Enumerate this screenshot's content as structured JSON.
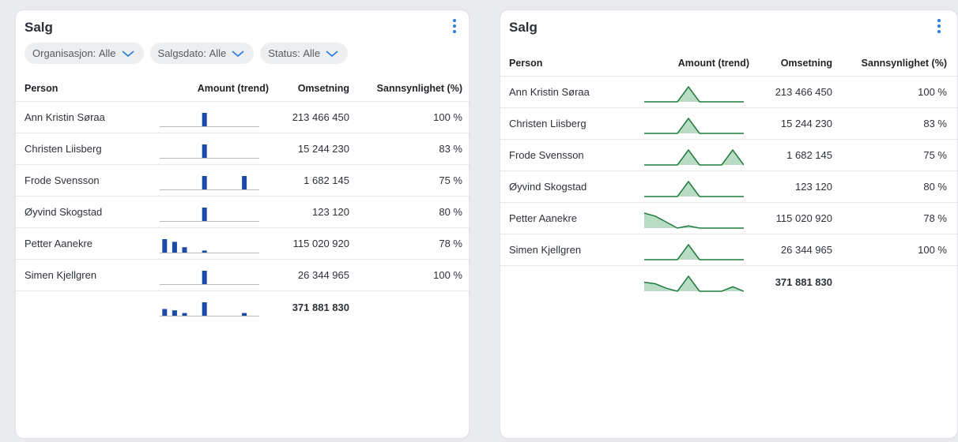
{
  "colors": {
    "bar": "#1b4aa8",
    "line": "#1e7a3c",
    "area": "#b8dcc4",
    "accent": "#2a7de1"
  },
  "left": {
    "title": "Salg",
    "filters": [
      {
        "label": "Organisasjon:",
        "value": "Alle"
      },
      {
        "label": "Salgsdato:",
        "value": "Alle"
      },
      {
        "label": "Status:",
        "value": "Alle"
      }
    ],
    "columns": {
      "person": "Person",
      "trend": "Amount (trend)",
      "omsetning": "Omsetning",
      "sannsynlighet": "Sannsynlighet (%)"
    },
    "rows": [
      {
        "person": "Ann Kristin Søraa",
        "omsetning": "213 466 450",
        "sannsynlighet": "100 %",
        "trend": [
          0,
          0,
          0,
          0,
          1,
          0,
          0,
          0,
          0,
          0
        ]
      },
      {
        "person": "Christen Liisberg",
        "omsetning": "15 244 230",
        "sannsynlighet": "83 %",
        "trend": [
          0,
          0,
          0,
          0,
          1,
          0,
          0,
          0,
          0,
          0
        ]
      },
      {
        "person": "Frode Svensson",
        "omsetning": "1 682 145",
        "sannsynlighet": "75 %",
        "trend": [
          0,
          0,
          0,
          0,
          1,
          0,
          0,
          0,
          1,
          0
        ]
      },
      {
        "person": "Øyvind Skogstad",
        "omsetning": "123 120",
        "sannsynlighet": "80 %",
        "trend": [
          0,
          0,
          0,
          0,
          1,
          0,
          0,
          0,
          0,
          0
        ]
      },
      {
        "person": "Petter Aanekre",
        "omsetning": "115 020 920",
        "sannsynlighet": "78 %",
        "trend": [
          1,
          0.8,
          0.4,
          0,
          0.15,
          0,
          0,
          0,
          0,
          0
        ]
      },
      {
        "person": "Simen Kjellgren",
        "omsetning": "26 344 965",
        "sannsynlighet": "100 %",
        "trend": [
          0,
          0,
          0,
          0,
          1,
          0,
          0,
          0,
          0,
          0
        ]
      }
    ],
    "total": {
      "omsetning": "371 881 830",
      "trend": [
        0.5,
        0.4,
        0.2,
        0,
        1,
        0,
        0,
        0,
        0.2,
        0
      ]
    }
  },
  "right": {
    "title": "Salg",
    "columns": {
      "person": "Person",
      "trend": "Amount (trend)",
      "omsetning": "Omsetning",
      "sannsynlighet": "Sannsynlighet (%)"
    },
    "rows": [
      {
        "person": "Ann Kristin Søraa",
        "omsetning": "213 466 450",
        "sannsynlighet": "100 %",
        "trend": [
          0,
          0,
          0,
          0,
          1,
          0,
          0,
          0,
          0,
          0
        ]
      },
      {
        "person": "Christen Liisberg",
        "omsetning": "15 244 230",
        "sannsynlighet": "83 %",
        "trend": [
          0,
          0,
          0,
          0,
          1,
          0,
          0,
          0,
          0,
          0
        ]
      },
      {
        "person": "Frode Svensson",
        "omsetning": "1 682 145",
        "sannsynlighet": "75 %",
        "trend": [
          0,
          0,
          0,
          0,
          1,
          0,
          0,
          0,
          1,
          0
        ]
      },
      {
        "person": "Øyvind Skogstad",
        "omsetning": "123 120",
        "sannsynlighet": "80 %",
        "trend": [
          0,
          0,
          0,
          0,
          1,
          0,
          0,
          0,
          0,
          0
        ]
      },
      {
        "person": "Petter Aanekre",
        "omsetning": "115 020 920",
        "sannsynlighet": "78 %",
        "trend": [
          1,
          0.8,
          0.4,
          0,
          0.15,
          0,
          0,
          0,
          0,
          0
        ]
      },
      {
        "person": "Simen Kjellgren",
        "omsetning": "26 344 965",
        "sannsynlighet": "100 %",
        "trend": [
          0,
          0,
          0,
          0,
          1,
          0,
          0,
          0,
          0,
          0
        ]
      }
    ],
    "total": {
      "omsetning": "371 881 830",
      "trend": [
        0.6,
        0.5,
        0.2,
        0,
        1,
        0,
        0,
        0,
        0.3,
        0
      ]
    }
  }
}
